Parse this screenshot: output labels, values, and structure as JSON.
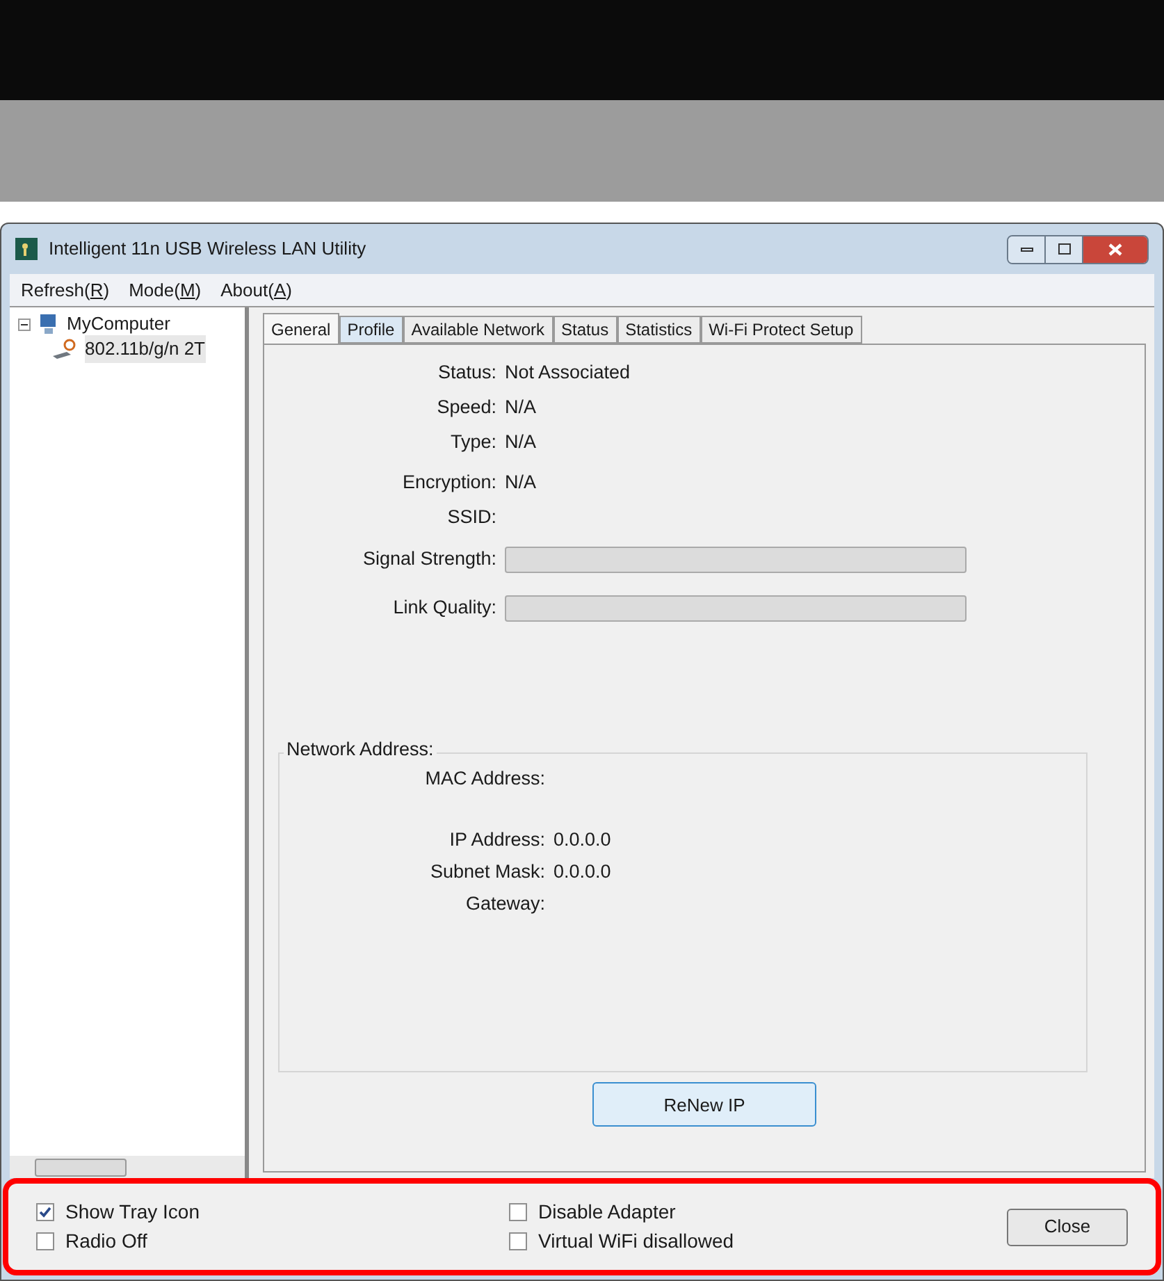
{
  "window": {
    "title": "Intelligent 11n USB Wireless LAN Utility"
  },
  "menu": [
    {
      "label": "Refresh(",
      "key": "R",
      "end": ")"
    },
    {
      "label": "Mode(",
      "key": "M",
      "end": ")"
    },
    {
      "label": "About(",
      "key": "A",
      "end": ")"
    }
  ],
  "tree": {
    "label": "MyComputer",
    "expanded": true,
    "children": [
      {
        "label": "802.11b/g/n 2T"
      }
    ]
  },
  "tabs": [
    {
      "label": "General",
      "selected": true
    },
    {
      "label": "Profile",
      "selected": false
    },
    {
      "label": "Available Network",
      "selected": false
    },
    {
      "label": "Status",
      "selected": false
    },
    {
      "label": "Statistics",
      "selected": false
    },
    {
      "label": "Wi-Fi Protect Setup",
      "selected": false
    }
  ],
  "info": [
    {
      "label": "Status:",
      "value": "Not Associated"
    },
    {
      "label": "Speed:",
      "value": "N/A"
    },
    {
      "label": "Type:",
      "value": "N/A"
    },
    {
      "label": "Encryption:",
      "value": "N/A"
    },
    {
      "label": "SSID:"
    }
  ],
  "meters": [
    {
      "label": "Signal Strength:"
    },
    {
      "label": "Link Quality:"
    }
  ],
  "network_address": {
    "title": "Network Address:",
    "fields": [
      {
        "label": "MAC Address:"
      },
      {
        "label": "IP Address:",
        "value": "0.0.0.0"
      },
      {
        "label": "Subnet Mask:",
        "value": "0.0.0.0"
      },
      {
        "label": "Gateway:"
      }
    ]
  },
  "renew_button": "ReNew IP",
  "options": [
    {
      "label": "Show Tray Icon",
      "checked": true
    },
    {
      "label": "Radio Off",
      "checked": false
    },
    {
      "label": "Disable Adapter",
      "checked": false
    },
    {
      "label": "Virtual WiFi disallowed",
      "checked": false
    }
  ],
  "close_button": "Close"
}
